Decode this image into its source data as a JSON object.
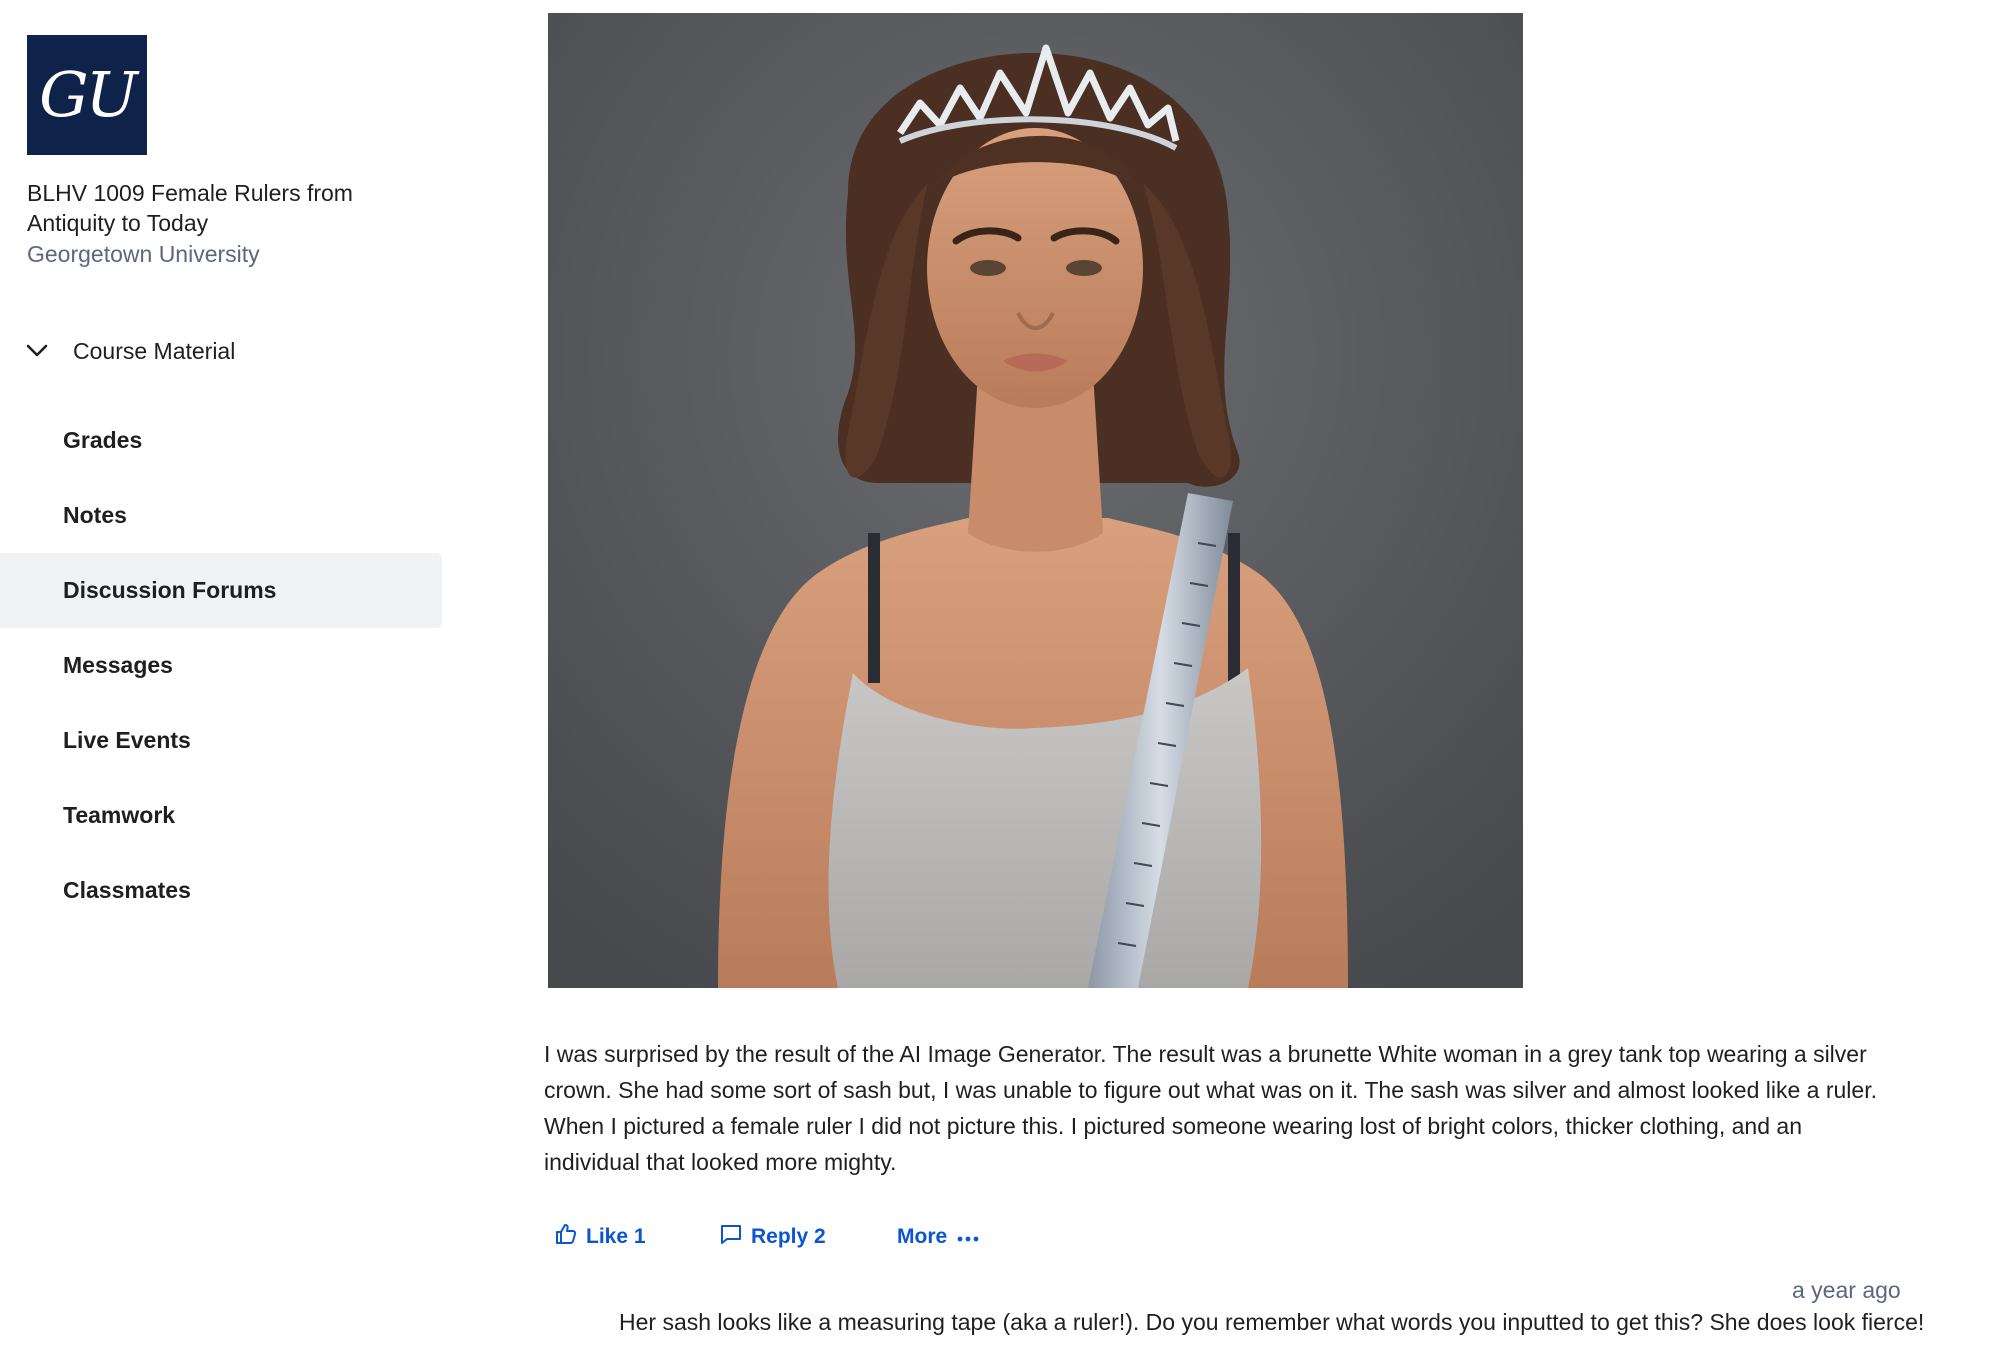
{
  "sidebar": {
    "logo_text": "GU",
    "course_title": "BLHV 1009 Female Rulers from Antiquity to Today",
    "university": "Georgetown University",
    "section_label": "Course Material",
    "nav_items": [
      {
        "label": "Grades"
      },
      {
        "label": "Notes"
      },
      {
        "label": "Discussion Forums",
        "active": true
      },
      {
        "label": "Messages"
      },
      {
        "label": "Live Events"
      },
      {
        "label": "Teamwork"
      },
      {
        "label": "Classmates"
      }
    ]
  },
  "post": {
    "image_icon": "ai-generated-portrait-image",
    "text": "I was surprised by the result of the AI Image Generator. The result was a brunette White woman in a grey tank top wearing a silver crown. She had some sort of sash but, I was unable to figure out what was on it. The sash was silver and almost looked like a ruler. When I pictured a female ruler I did not picture this. I pictured someone wearing lost of bright colors, thicker clothing, and an individual that looked more mighty.",
    "actions": {
      "like_label": "Like 1",
      "reply_label": "Reply 2",
      "more_label": "More"
    }
  },
  "reply": {
    "timestamp": "a year ago",
    "text": "Her sash looks like a measuring tape (aka a ruler!). Do you remember what words you inputted to get this? She does look fierce!"
  },
  "colors": {
    "logo_bg": "#0f2249",
    "link_blue": "#0b56d0",
    "muted": "#5b6780",
    "active_nav_bg": "#f0f2f6"
  }
}
